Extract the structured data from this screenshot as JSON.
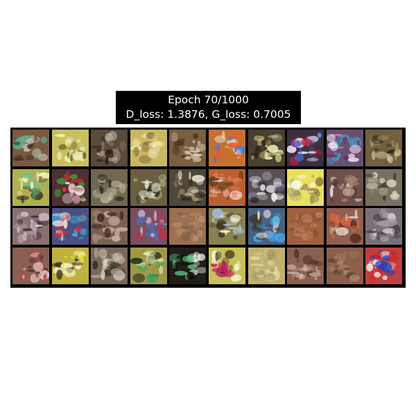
{
  "title": {
    "line1": "Epoch 70/1000",
    "line2": "D_loss: 1.3876, G_loss: 0.7005"
  },
  "grid": {
    "rows": 4,
    "cols": 10,
    "colors": {
      "background": "#000000",
      "title_bg": "#000000",
      "title_text": "#ffffff"
    },
    "samples": [
      {
        "bg": "#7a5a40",
        "c": [
          "#c9c0b0",
          "#3a2a22",
          "#5fae8a"
        ]
      },
      {
        "bg": "#c8c060",
        "c": [
          "#f5f0a0",
          "#6a6030",
          "#e8e8c0"
        ]
      },
      {
        "bg": "#5a4a3a",
        "c": [
          "#d0c8c0",
          "#2a2018",
          "#8a7a6a"
        ]
      },
      {
        "bg": "#c8b860",
        "c": [
          "#f0f0b0",
          "#8a6a40",
          "#e0d8a0"
        ]
      },
      {
        "bg": "#7a6040",
        "c": [
          "#c8b8a0",
          "#3a2a1a",
          "#e0d0c0"
        ]
      },
      {
        "bg": "#c87030",
        "c": [
          "#e05a30",
          "#4878c8",
          "#e8d8c0"
        ]
      },
      {
        "bg": "#4a4030",
        "c": [
          "#f8f8c0",
          "#2a2010",
          "#c8c080"
        ]
      },
      {
        "bg": "#3a3040",
        "c": [
          "#f0e8f8",
          "#4060c0",
          "#c02040"
        ]
      },
      {
        "bg": "#6a5070",
        "c": [
          "#f0e0f0",
          "#40a0c0",
          "#802060"
        ]
      },
      {
        "bg": "#706040",
        "c": [
          "#d8d0a0",
          "#2a2a1a",
          "#a09060"
        ]
      },
      {
        "bg": "#b0b050",
        "c": [
          "#f8f8c0",
          "#3a3020",
          "#60c0a0"
        ]
      },
      {
        "bg": "#503030",
        "c": [
          "#e03030",
          "#40a040",
          "#f0f0f0"
        ]
      },
      {
        "bg": "#706850",
        "c": [
          "#c0b8a0",
          "#303020",
          "#a0a080"
        ]
      },
      {
        "bg": "#6a6040",
        "c": [
          "#f0f0e0",
          "#2a2818",
          "#c8c0a0"
        ]
      },
      {
        "bg": "#504838",
        "c": [
          "#e8e0d0",
          "#2a2018",
          "#a09070"
        ]
      },
      {
        "bg": "#b86030",
        "c": [
          "#e07050",
          "#f0d0c0",
          "#604020"
        ]
      },
      {
        "bg": "#5a5050",
        "c": [
          "#f0f0f0",
          "#202030",
          "#a0a0b0"
        ]
      },
      {
        "bg": "#e8e060",
        "c": [
          "#8a7040",
          "#a0a070",
          "#f8f8e0"
        ]
      },
      {
        "bg": "#705048",
        "c": [
          "#c0a090",
          "#e0e0e0",
          "#503028"
        ]
      },
      {
        "bg": "#7a7060",
        "c": [
          "#d0d0c0",
          "#3a3028",
          "#a09888"
        ]
      },
      {
        "bg": "#8a7070",
        "c": [
          "#d8c8d0",
          "#403038",
          "#b09098"
        ]
      },
      {
        "bg": "#4a5080",
        "c": [
          "#e03030",
          "#40b0e0",
          "#f0e0e0"
        ]
      },
      {
        "bg": "#7a6050",
        "c": [
          "#c8b0a0",
          "#3a2a20",
          "#a08878"
        ]
      },
      {
        "bg": "#7a5060",
        "c": [
          "#4070c0",
          "#d8b8c8",
          "#c03040"
        ]
      },
      {
        "bg": "#9a7050",
        "c": [
          "#b08060",
          "#806048",
          "#c09070"
        ]
      },
      {
        "bg": "#8a8050",
        "c": [
          "#f0f0d0",
          "#403828",
          "#a0c0e0"
        ]
      },
      {
        "bg": "#4a6080",
        "c": [
          "#40b0f0",
          "#f0e8d0",
          "#403020"
        ]
      },
      {
        "bg": "#a06040",
        "c": [
          "#c08060",
          "#804830",
          "#b87858"
        ]
      },
      {
        "bg": "#906050",
        "c": [
          "#e06040",
          "#e8d8c8",
          "#503020"
        ]
      },
      {
        "bg": "#7a7078",
        "c": [
          "#d0c8d0",
          "#403840",
          "#a098a0"
        ]
      },
      {
        "bg": "#8a6050",
        "c": [
          "#f0e0d8",
          "#402820",
          "#c04050"
        ]
      },
      {
        "bg": "#c0b040",
        "c": [
          "#f8f8d0",
          "#202010",
          "#e8e050"
        ]
      },
      {
        "bg": "#7a6858",
        "c": [
          "#d8d0c8",
          "#303020",
          "#b0a090"
        ]
      },
      {
        "bg": "#a09848",
        "c": [
          "#f0f0c0",
          "#2a2818",
          "#40a060"
        ]
      },
      {
        "bg": "#202018",
        "c": [
          "#f8f8f0",
          "#60c080",
          "#101008"
        ]
      },
      {
        "bg": "#c8c058",
        "c": [
          "#f8f8d0",
          "#403020",
          "#c02060"
        ]
      },
      {
        "bg": "#c0b070",
        "c": [
          "#e0d8a0",
          "#a09060",
          "#d0c890"
        ]
      },
      {
        "bg": "#8a6050",
        "c": [
          "#c8a090",
          "#503028",
          "#e0d0c8"
        ]
      },
      {
        "bg": "#8a6048",
        "c": [
          "#b08870",
          "#604030",
          "#a07860"
        ]
      },
      {
        "bg": "#c04040",
        "c": [
          "#e02020",
          "#f0f0f0",
          "#2040c0"
        ]
      }
    ]
  }
}
